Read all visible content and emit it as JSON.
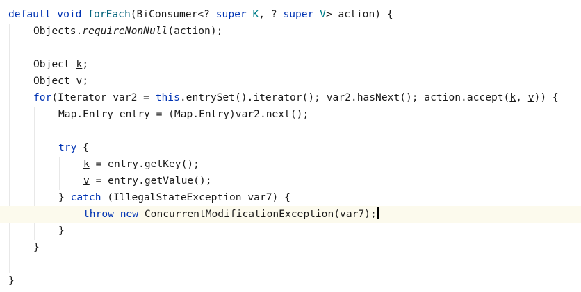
{
  "editor": {
    "lines": [
      {
        "segments": [
          {
            "text": "default void ",
            "cls": "kw"
          },
          {
            "text": "forEach",
            "cls": "fn"
          },
          {
            "text": "(BiConsumer<? ",
            "cls": ""
          },
          {
            "text": "super ",
            "cls": "kw"
          },
          {
            "text": "K",
            "cls": "tp"
          },
          {
            "text": ", ? ",
            "cls": ""
          },
          {
            "text": "super ",
            "cls": "kw"
          },
          {
            "text": "V",
            "cls": "tp"
          },
          {
            "text": "> action) {",
            "cls": ""
          }
        ]
      },
      {
        "segments": [
          {
            "text": "Objects.",
            "cls": ""
          },
          {
            "text": "requireNonNull",
            "cls": "it"
          },
          {
            "text": "(action);",
            "cls": ""
          }
        ]
      },
      {
        "segments": []
      },
      {
        "segments": [
          {
            "text": "Object ",
            "cls": ""
          },
          {
            "text": "k",
            "cls": "ul"
          },
          {
            "text": ";",
            "cls": ""
          }
        ]
      },
      {
        "segments": [
          {
            "text": "Object ",
            "cls": ""
          },
          {
            "text": "v",
            "cls": "ul"
          },
          {
            "text": ";",
            "cls": ""
          }
        ]
      },
      {
        "segments": [
          {
            "text": "for",
            "cls": "kw"
          },
          {
            "text": "(Iterator var2 = ",
            "cls": ""
          },
          {
            "text": "this",
            "cls": "kw"
          },
          {
            "text": ".entrySet().iterator(); var2.hasNext(); action.accept(",
            "cls": ""
          },
          {
            "text": "k",
            "cls": "ul"
          },
          {
            "text": ", ",
            "cls": ""
          },
          {
            "text": "v",
            "cls": "ul"
          },
          {
            "text": ")) {",
            "cls": ""
          }
        ]
      },
      {
        "segments": [
          {
            "text": "Map.Entry entry = (Map.Entry)var2.next();",
            "cls": ""
          }
        ]
      },
      {
        "segments": []
      },
      {
        "segments": [
          {
            "text": "try",
            "cls": "kw"
          },
          {
            "text": " {",
            "cls": ""
          }
        ]
      },
      {
        "segments": [
          {
            "text": "k",
            "cls": "ul"
          },
          {
            "text": " = entry.getKey();",
            "cls": ""
          }
        ]
      },
      {
        "segments": [
          {
            "text": "v",
            "cls": "ul"
          },
          {
            "text": " = entry.getValue();",
            "cls": ""
          }
        ]
      },
      {
        "segments": [
          {
            "text": "} ",
            "cls": ""
          },
          {
            "text": "catch",
            "cls": "kw"
          },
          {
            "text": " (IllegalStateException var7) {",
            "cls": ""
          }
        ]
      },
      {
        "segments": [
          {
            "text": "throw new ",
            "cls": "kw"
          },
          {
            "text": "ConcurrentModificationException(var7);",
            "cls": ""
          }
        ],
        "current": true
      },
      {
        "segments": [
          {
            "text": "}",
            "cls": ""
          }
        ]
      },
      {
        "segments": [
          {
            "text": "}",
            "cls": ""
          }
        ]
      },
      {
        "segments": []
      },
      {
        "segments": [
          {
            "text": "}",
            "cls": ""
          }
        ]
      }
    ]
  },
  "colors": {
    "keyword": "#0033b3",
    "method_name": "#00627a",
    "type_param": "#007e8a",
    "current_line": "#fcfaed"
  }
}
